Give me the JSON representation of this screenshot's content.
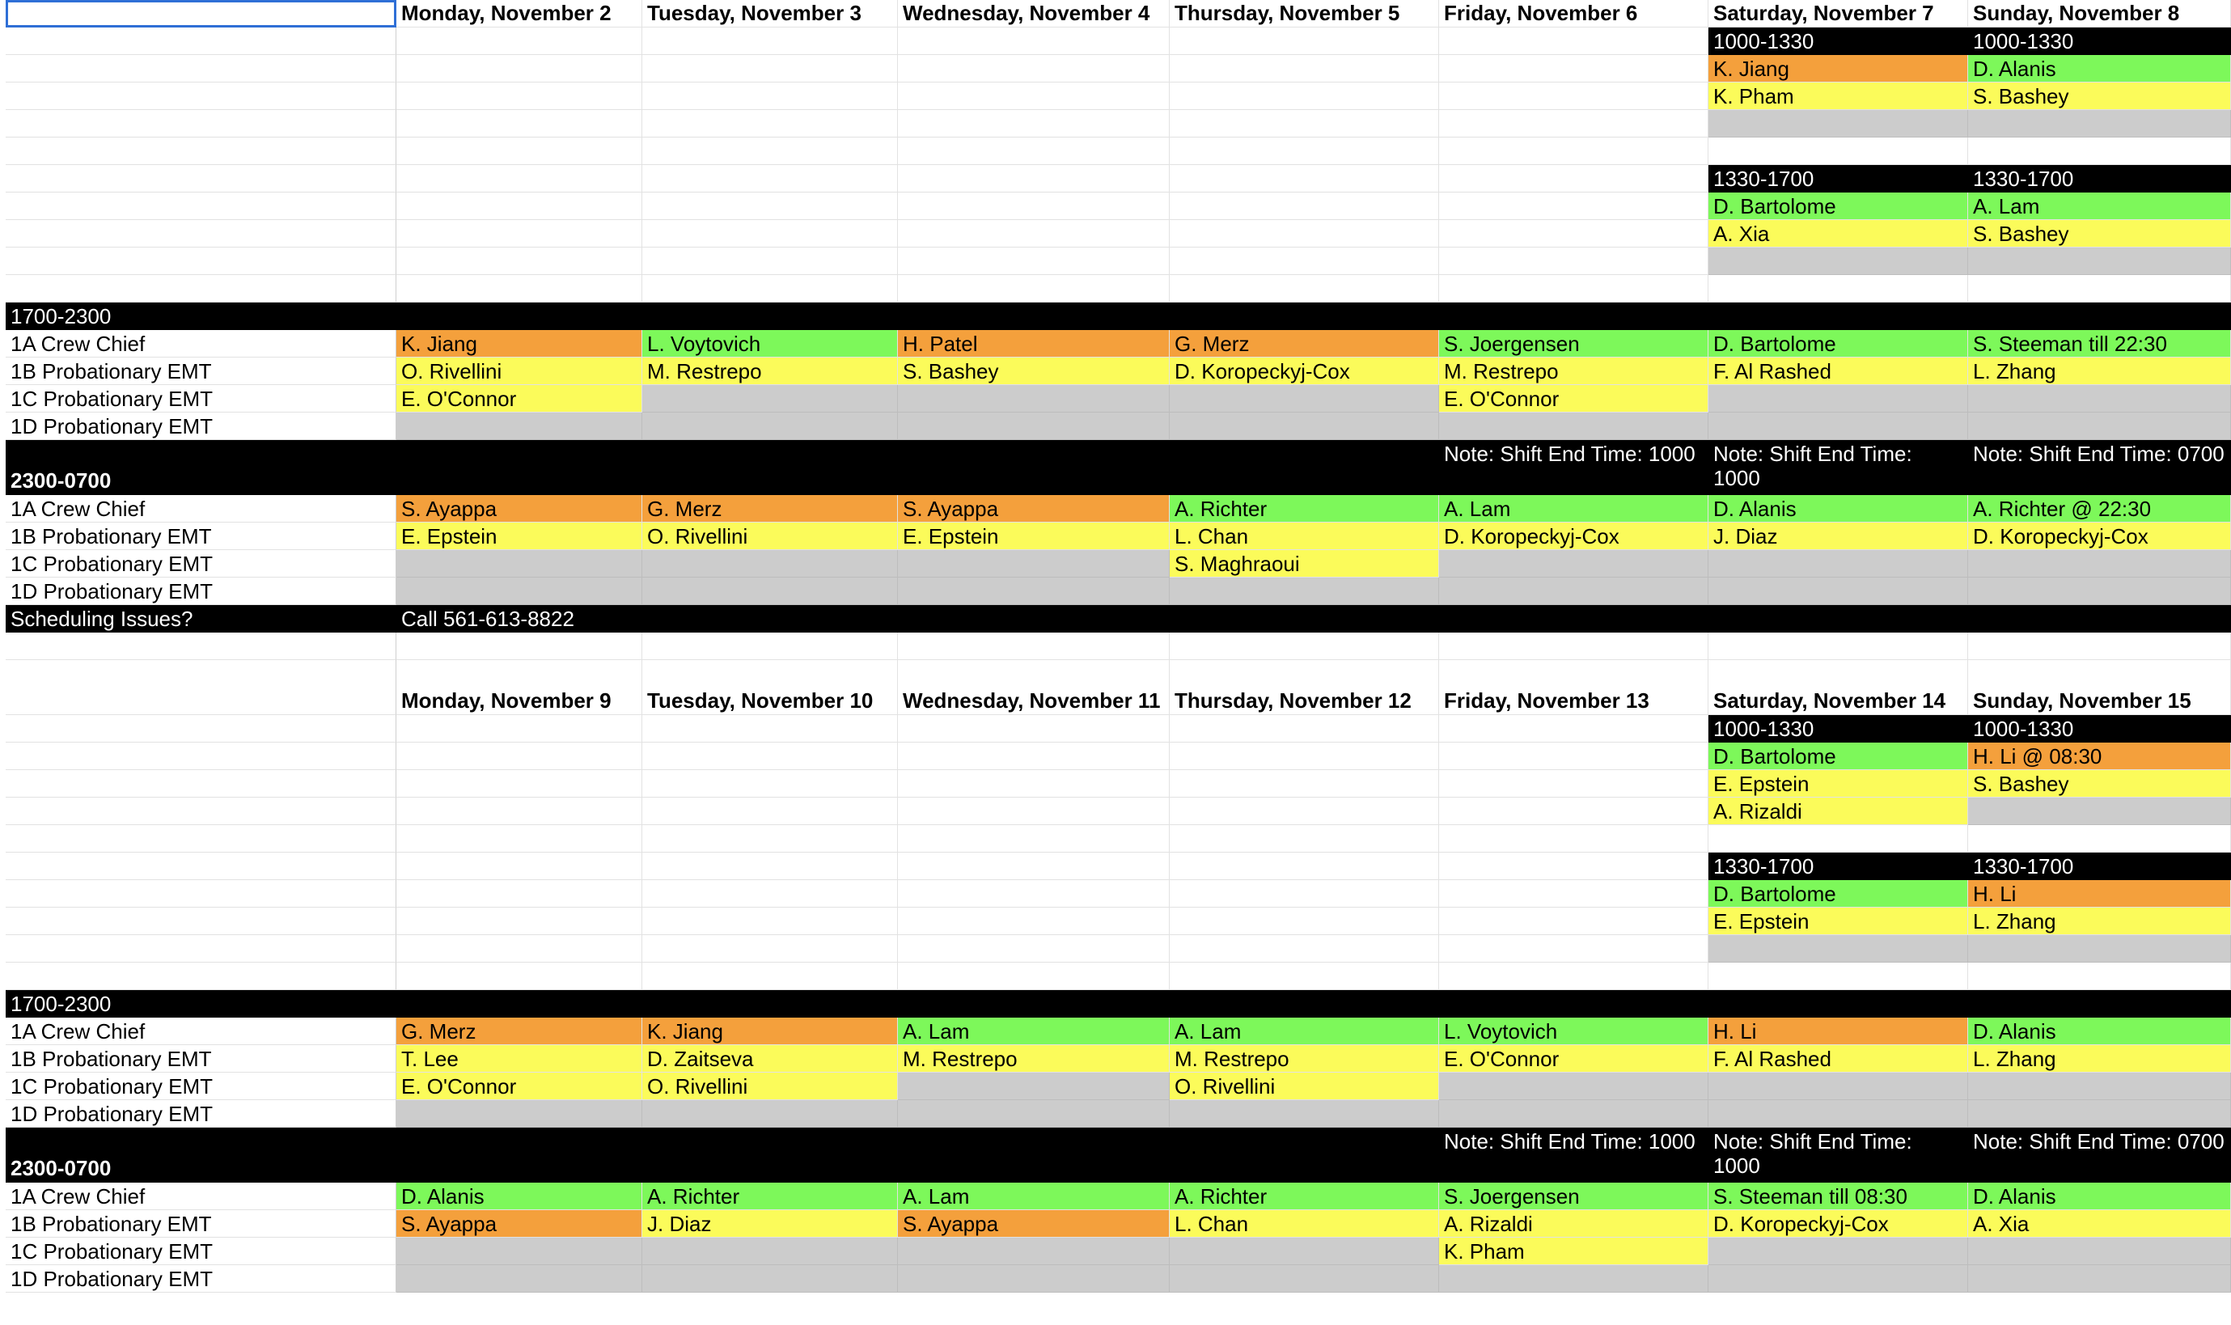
{
  "colors": {
    "orange": "#f4a03c",
    "green": "#7df85a",
    "yellow": "#fbfb5a",
    "grey": "#cccccc",
    "black": "#000000"
  },
  "week1": {
    "days": [
      "Monday, November 2",
      "Tuesday, November 3",
      "Wednesday, November 4",
      "Thursday, November 5",
      "Friday, November 6",
      "Saturday, November 7",
      "Sunday, November 8"
    ],
    "weekend_day": {
      "shift_a": "1000-1330",
      "sat_a": [
        "K. Jiang",
        "K. Pham"
      ],
      "sun_a": [
        "D. Alanis",
        "S. Bashey"
      ],
      "shift_b": "1330-1700",
      "sat_b": [
        "D. Bartolome",
        "A. Xia"
      ],
      "sun_b": [
        "A. Lam",
        "S. Bashey"
      ]
    },
    "evening": {
      "label": "1700-2300",
      "roles": [
        "1A Crew Chief",
        "1B Probationary EMT",
        "1C Probationary EMT",
        "1D Probationary EMT"
      ],
      "r1a": [
        "K. Jiang",
        "L. Voytovich",
        "H. Patel",
        "G. Merz",
        "S. Joergensen",
        "D. Bartolome",
        "S. Steeman till 22:30"
      ],
      "r1b": [
        "O. Rivellini",
        "M. Restrepo",
        "S. Bashey",
        "D. Koropeckyj-Cox",
        "M. Restrepo",
        "F. Al Rashed",
        "L. Zhang"
      ],
      "r1c": [
        "E. O'Connor",
        "",
        "",
        "",
        "E. O'Connor",
        "",
        ""
      ]
    },
    "night": {
      "label": "2300-0700",
      "notes": [
        "Note: Shift End Time: 1000",
        "Note: Shift End Time: 1000",
        "Note: Shift End Time: 0700"
      ],
      "r1a": [
        "S. Ayappa",
        "G. Merz",
        "S. Ayappa",
        "A. Richter",
        "A. Lam",
        "D. Alanis",
        "A. Richter @ 22:30"
      ],
      "r1b": [
        "E. Epstein",
        "O. Rivellini",
        "E. Epstein",
        "L. Chan",
        "D. Koropeckyj-Cox",
        "J. Diaz",
        "D. Koropeckyj-Cox"
      ],
      "r1c": [
        "",
        "",
        "",
        "S. Maghraoui",
        "",
        "",
        ""
      ]
    },
    "issues_label": "Scheduling Issues?",
    "issues_phone": "Call 561-613-8822"
  },
  "week2": {
    "days": [
      "Monday, November 9",
      "Tuesday, November 10",
      "Wednesday, November 11",
      "Thursday, November 12",
      "Friday, November 13",
      "Saturday, November 14",
      "Sunday, November 15"
    ],
    "weekend_day": {
      "shift_a": "1000-1330",
      "sat_a": [
        "D. Bartolome",
        "E. Epstein",
        "A. Rizaldi"
      ],
      "sun_a": [
        "H. Li @ 08:30",
        "S. Bashey",
        ""
      ],
      "shift_b": "1330-1700",
      "sat_b": [
        "D. Bartolome",
        "E. Epstein"
      ],
      "sun_b": [
        "H. Li",
        "L. Zhang"
      ]
    },
    "evening": {
      "label": "1700-2300",
      "r1a": [
        "G. Merz",
        "K. Jiang",
        "A. Lam",
        "A. Lam",
        "L. Voytovich",
        "H. Li",
        "D. Alanis"
      ],
      "r1b": [
        "T. Lee",
        "D. Zaitseva",
        "M. Restrepo",
        "M. Restrepo",
        "E. O'Connor",
        "F. Al Rashed",
        "L. Zhang"
      ],
      "r1c": [
        "E. O'Connor",
        "O. Rivellini",
        "",
        "O. Rivellini",
        "",
        "",
        ""
      ]
    },
    "night": {
      "label": "2300-0700",
      "notes": [
        "Note: Shift End Time: 1000",
        "Note: Shift End Time: 1000",
        "Note: Shift End Time: 0700"
      ],
      "r1a": [
        "D. Alanis",
        "A. Richter",
        "A. Lam",
        "A. Richter",
        "S. Joergensen",
        "S. Steeman till 08:30",
        "D. Alanis"
      ],
      "r1b": [
        "S. Ayappa",
        "J. Diaz",
        "S. Ayappa",
        "L. Chan",
        "A. Rizaldi",
        "D. Koropeckyj-Cox",
        "A. Xia"
      ],
      "r1c": [
        "",
        "",
        "",
        "",
        "K. Pham",
        "",
        ""
      ]
    }
  }
}
